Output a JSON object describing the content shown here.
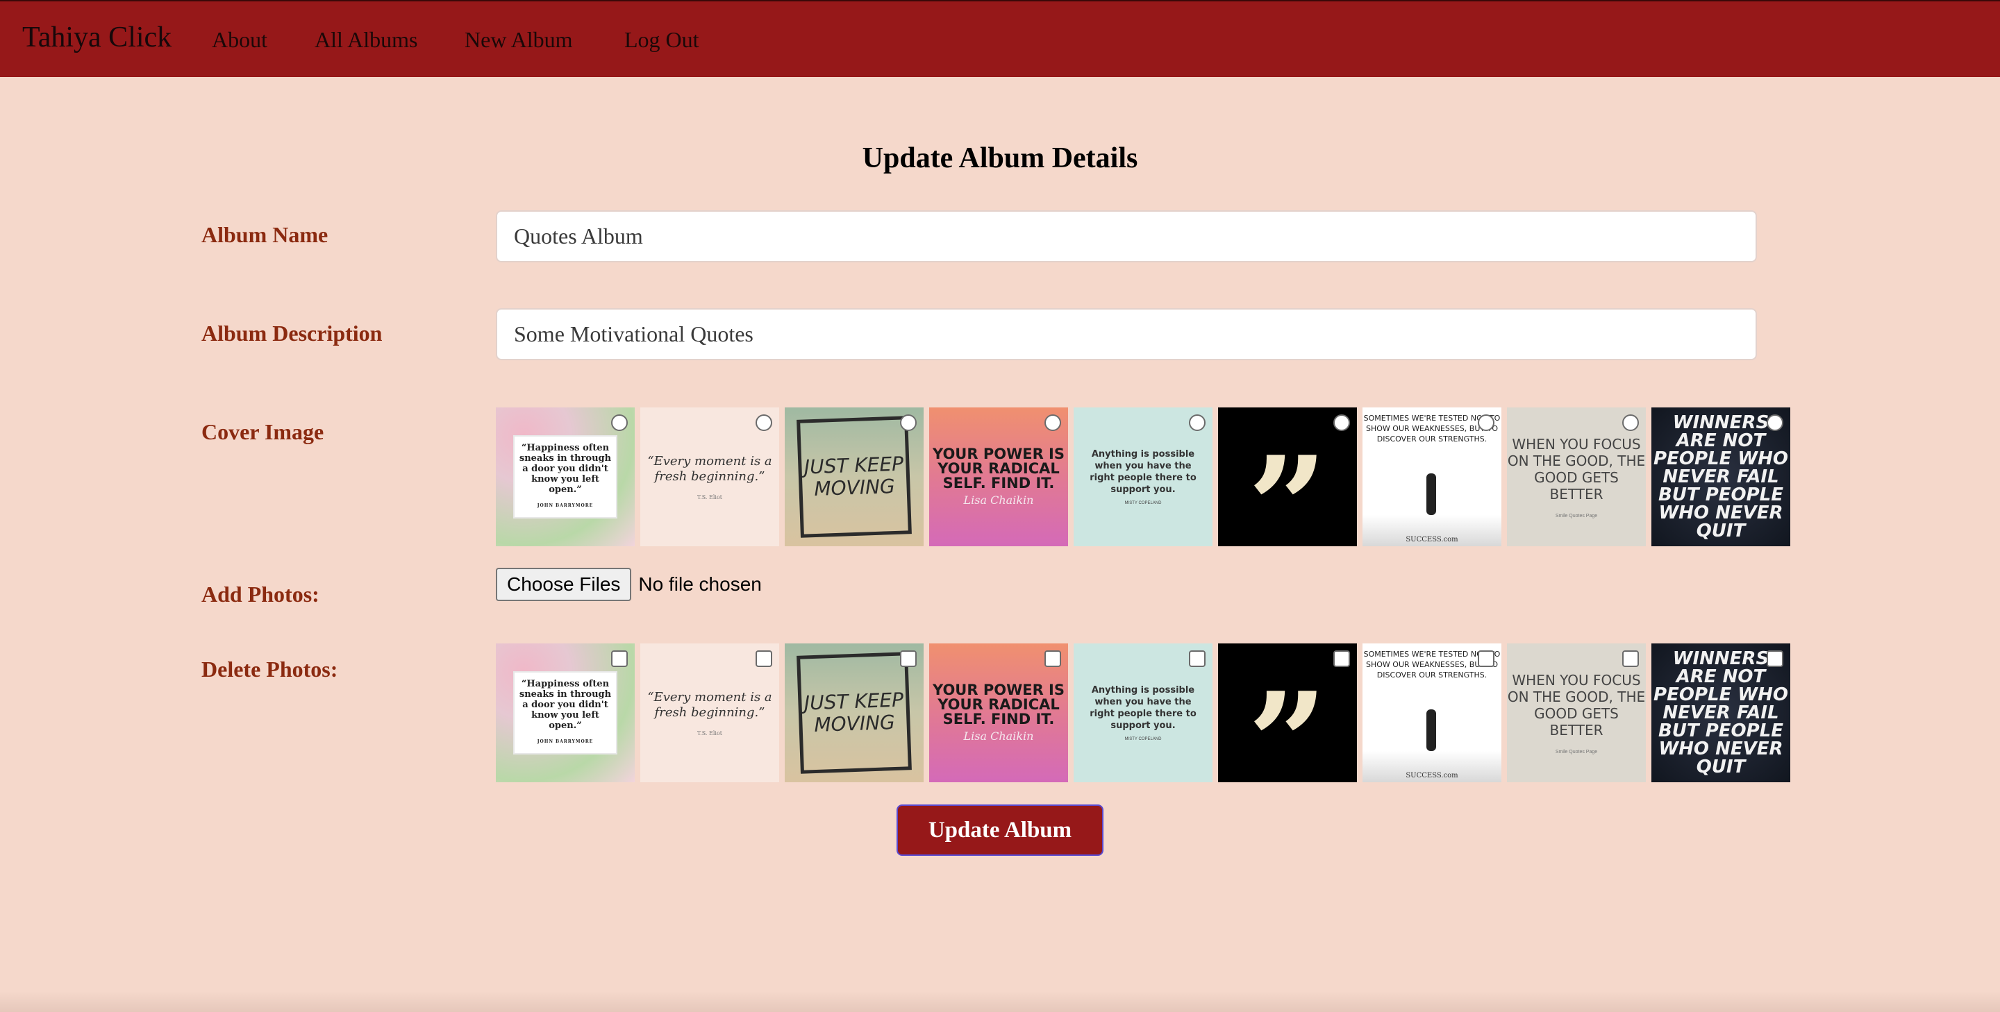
{
  "nav": {
    "brand": "Tahiya Click",
    "links": [
      "About",
      "All Albums",
      "New Album",
      "Log Out"
    ]
  },
  "form": {
    "title": "Update Album Details",
    "album_name_label": "Album Name",
    "album_name_value": "Quotes Album",
    "album_description_label": "Album Description",
    "album_description_value": "Some Motivational Quotes",
    "cover_image_label": "Cover Image",
    "add_photos_label": "Add Photos:",
    "file_button_label": "Choose Files",
    "file_status": "No file chosen",
    "delete_photos_label": "Delete Photos:",
    "submit_label": "Update Album"
  },
  "photos": [
    {
      "text": "“Happiness often sneaks in through a door you didn't know you left open.”",
      "by": "JOHN BARRYMORE"
    },
    {
      "text": "“Every moment is a fresh beginning.”",
      "by": "T.S. Eliot"
    },
    {
      "text": "JUST KEEP MOVING"
    },
    {
      "text": "YOUR POWER IS YOUR RADICAL SELF. FIND IT.",
      "by": "Lisa Chaikin"
    },
    {
      "text": "Anything is possible when you have the right people there to support you.",
      "by": "MISTY COPELAND"
    },
    {
      "text": "”"
    },
    {
      "text": "SOMETIMES WE'RE TESTED NOT TO SHOW OUR WEAKNESSES, BUT TO DISCOVER OUR STRENGTHS.",
      "by": "SUCCESS.com"
    },
    {
      "text": "WHEN YOU FOCUS ON THE GOOD, THE GOOD GETS BETTER",
      "by": "Smile Quotes Page"
    },
    {
      "text": "WINNERS ARE NOT PEOPLE WHO NEVER FAIL BUT PEOPLE WHO NEVER QUIT"
    }
  ],
  "colors": {
    "navbar": "#961819",
    "page_background": "#f5d8cb",
    "label_text": "#8b2a10",
    "button": "#961819"
  }
}
